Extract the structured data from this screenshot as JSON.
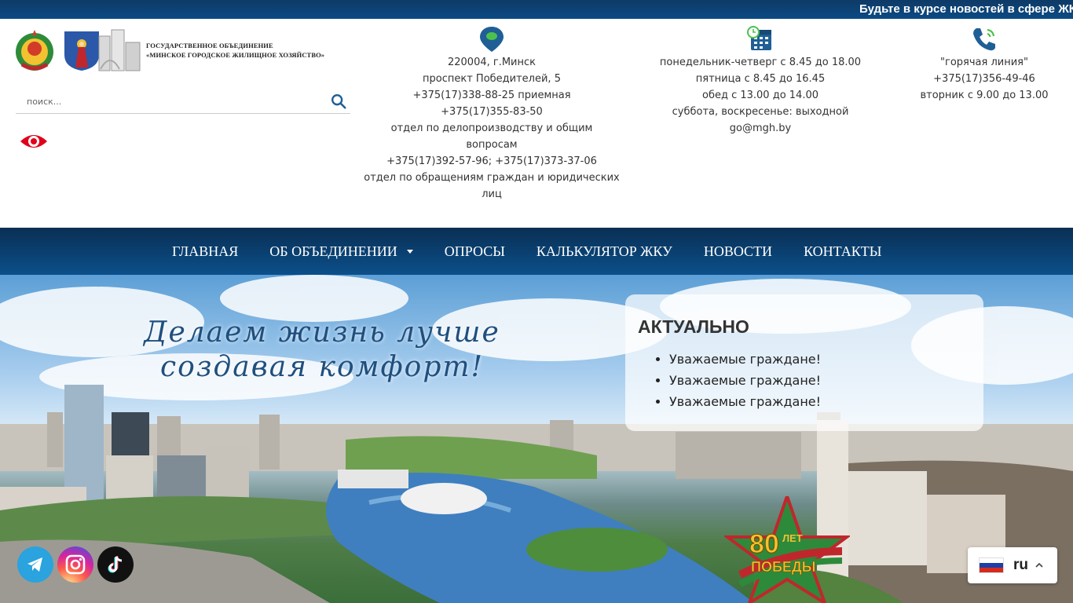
{
  "ticker": {
    "text": "Будьте в курсе новостей в сфере ЖКХ"
  },
  "logo": {
    "line1": "ГОСУДАРСТВЕННОЕ ОБЪЕДИНЕНИЕ",
    "line2": "«МИНСКОЕ ГОРОДСКОЕ ЖИЛИЩНОЕ  ХОЗЯЙСТВО»"
  },
  "search": {
    "placeholder": "поиск..."
  },
  "address": {
    "icon": "location-pin-icon",
    "lines": [
      "220004, г.Минск",
      "проспект Победителей, 5",
      "+375(17)338-88-25 приемная",
      "+375(17)355-83-50",
      "отдел по делопроизводству и общим",
      "вопросам",
      "+375(17)392-57-96; +375(17)373-37-06",
      "отдел по обращениям граждан и юридических",
      "лиц"
    ]
  },
  "hours": {
    "icon": "calendar-clock-icon",
    "lines": [
      "понедельник-четверг с 8.45 до 18.00",
      "пятница с 8.45 до 16.45",
      "обед с 13.00 до 14.00",
      "суббота, воскресенье: выходной",
      "go@mgh.by"
    ]
  },
  "hotline": {
    "icon": "phone-icon",
    "lines": [
      "\"горячая линия\"",
      "+375(17)356-49-46",
      "вторник с 9.00 до 13.00"
    ]
  },
  "nav": [
    {
      "label": "ГЛАВНАЯ"
    },
    {
      "label": "ОБ ОБЪЕДИНЕНИИ",
      "dropdown": true
    },
    {
      "label": "ОПРОСЫ"
    },
    {
      "label": "КАЛЬКУЛЯТОР ЖКУ"
    },
    {
      "label": "НОВОСТИ"
    },
    {
      "label": "КОНТАКТЫ"
    }
  ],
  "hero": {
    "slogan_line1": "Делаем жизнь лучше",
    "slogan_line2": "создавая комфорт!",
    "actual_title": "АКТУАЛЬНО",
    "actual_items": [
      "Уважаемые граждане!",
      "Уважаемые граждане!",
      "Уважаемые граждане!"
    ],
    "badge_number": "80",
    "badge_text": "ЛЕТ",
    "badge_text2": "ПОБЕДЫ"
  },
  "socials": [
    "telegram-icon",
    "instagram-icon",
    "tiktok-icon"
  ],
  "language": {
    "code": "ru"
  },
  "colors": {
    "brand_blue": "#0b4b84",
    "accent_red": "#e0001b",
    "icon_blue": "#1f5f96"
  }
}
